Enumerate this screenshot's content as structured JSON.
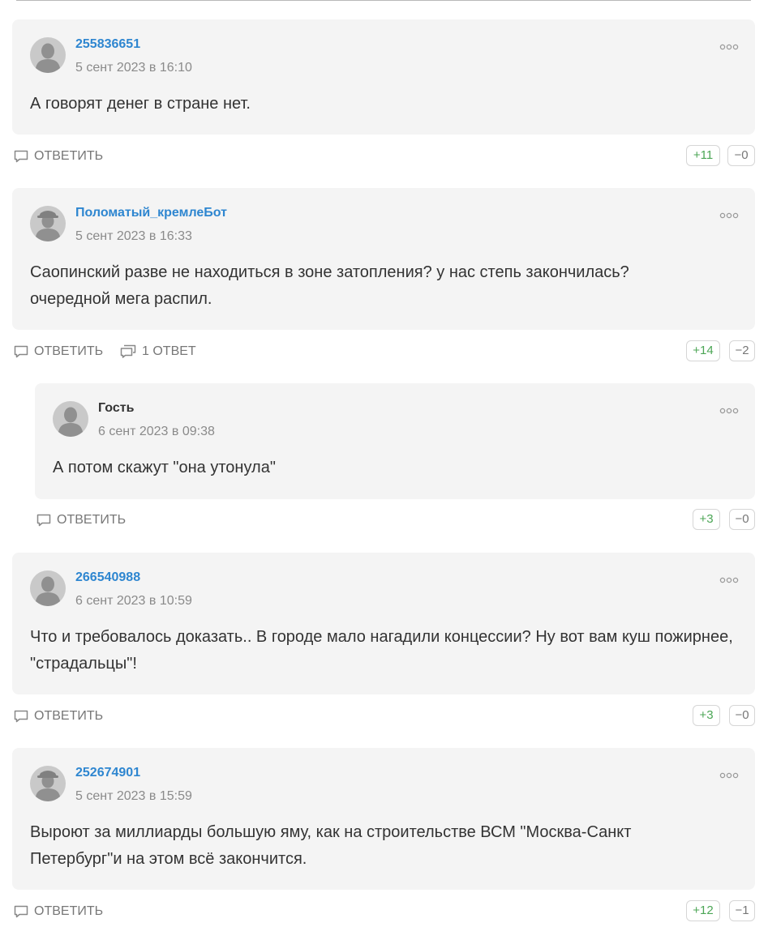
{
  "colors": {
    "card_bg": "#f4f4f4",
    "author_link": "#2e86d0",
    "plus_vote": "#4ca656",
    "muted": "#777777"
  },
  "comments": [
    {
      "author": "255836651",
      "date": "5 сент 2023 в 16:10",
      "text": "А говорят денег в стране нет.",
      "reply_label": "ОТВЕТИТЬ",
      "upvotes": "+11",
      "downvotes": "−0"
    },
    {
      "author": "Поломатый_кремлеБот",
      "date": "5 сент 2023 в 16:33",
      "text": "Саопинский разве не находиться в зоне затопления? у нас степь закончилась? очередной мега распил.",
      "reply_label": "ОТВЕТИТЬ",
      "replies_label": "1 ОТВЕТ",
      "upvotes": "+14",
      "downvotes": "−2"
    },
    {
      "author": "Гость",
      "date": "6 сент 2023 в 09:38",
      "text": "А потом скажут \"она утонула\"",
      "reply_label": "ОТВЕТИТЬ",
      "upvotes": "+3",
      "downvotes": "−0"
    },
    {
      "author": "266540988",
      "date": "6 сент 2023 в 10:59",
      "text": "Что и требовалось доказать.. В городе мало нагадили концессии? Ну вот вам куш пожирнее, \"страдальцы\"!",
      "reply_label": "ОТВЕТИТЬ",
      "upvotes": "+3",
      "downvotes": "−0"
    },
    {
      "author": "252674901",
      "date": "5 сент 2023 в 15:59",
      "text": "Выроют за миллиарды большую яму, как на строительстве ВСМ \"Москва-Санкт Петербург\"и на этом всё закончится.",
      "reply_label": "ОТВЕТИТЬ",
      "upvotes": "+12",
      "downvotes": "−1"
    }
  ]
}
